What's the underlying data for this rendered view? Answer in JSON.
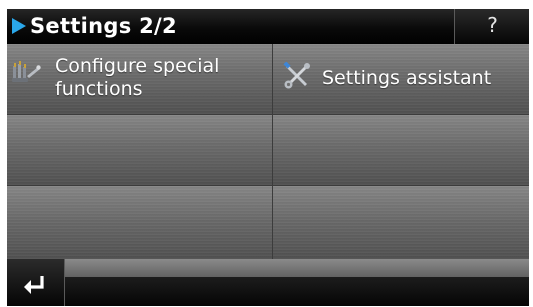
{
  "header": {
    "title": "Settings 2/2",
    "help_label": "?"
  },
  "tiles": [
    {
      "label_line1": "Configure special",
      "label_line2": "functions",
      "icon": "tools-icon"
    },
    {
      "label": "Settings assistant",
      "icon": "wrench-screwdriver-icon"
    }
  ],
  "footer": {
    "back_icon": "return-arrow-icon"
  },
  "colors": {
    "title_arrow": "#2aa7ea",
    "text": "#ffffff",
    "bar": "#000000"
  }
}
